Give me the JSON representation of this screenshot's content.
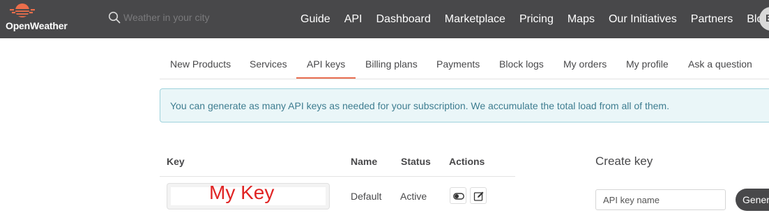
{
  "header": {
    "logo_text": "OpenWeather",
    "search": {
      "placeholder": "Weather in your city"
    },
    "nav": [
      {
        "label": "Guide"
      },
      {
        "label": "API"
      },
      {
        "label": "Dashboard"
      },
      {
        "label": "Marketplace"
      },
      {
        "label": "Pricing"
      },
      {
        "label": "Maps"
      },
      {
        "label": "Our Initiatives"
      },
      {
        "label": "Partners"
      },
      {
        "label": "Blog"
      }
    ],
    "avatar_initial": "B"
  },
  "tabs": [
    {
      "label": "New Products"
    },
    {
      "label": "Services"
    },
    {
      "label": "API keys",
      "active": true
    },
    {
      "label": "Billing plans"
    },
    {
      "label": "Payments"
    },
    {
      "label": "Block logs"
    },
    {
      "label": "My orders"
    },
    {
      "label": "My profile"
    },
    {
      "label": "Ask a question"
    }
  ],
  "alert": {
    "text": "You can generate as many API keys as needed for your subscription. We accumulate the total load from all of them."
  },
  "keys_table": {
    "headers": {
      "key": "Key",
      "name": "Name",
      "status": "Status",
      "actions": "Actions"
    },
    "rows": [
      {
        "key": "My Key",
        "name": "Default",
        "status": "Active"
      }
    ]
  },
  "create_key": {
    "title": "Create key",
    "input_placeholder": "API key name",
    "button_label": "Generate"
  },
  "colors": {
    "topbar": "#48484a",
    "accent": "#e96e50",
    "alert_bg": "#eaf6f8",
    "alert_text": "#3e7d90",
    "key_annotation": "#e02424"
  }
}
